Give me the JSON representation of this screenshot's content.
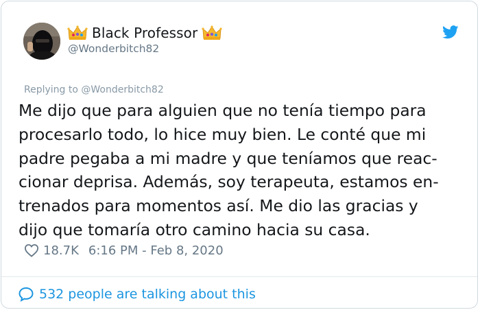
{
  "tweet": {
    "author": {
      "display_name": "Black Professor",
      "handle": "@Wonderbitch82",
      "avatar_icon": "masked-person-avatar",
      "name_decoration_icon": "crown-icon"
    },
    "platform_icon": "twitter-bird-icon",
    "replying_to": "Replying to @Wonderbitch82",
    "text": "Me dijo que para alguien que no tenía tiempo para\nprocesarlo todo, lo hice muy bien. Le conté que mi\npadre pegaba a mi madre y que teníamos que reac-\ncionar deprisa. Además, soy terapeuta, estamos en-\ntrenados para momentos así. Me dio las gracias y\ndijo que tomaría otro camino hacia su casa.",
    "likes": "18.7K",
    "time_date": "6:16 PM - Feb 8, 2020",
    "conversation": "532 people are talking about this"
  },
  "colors": {
    "text_primary": "#14171a",
    "text_secondary": "#657786",
    "link_blue": "#1b95e0",
    "twitter_blue": "#1da1f2",
    "border": "#cfd9de"
  }
}
